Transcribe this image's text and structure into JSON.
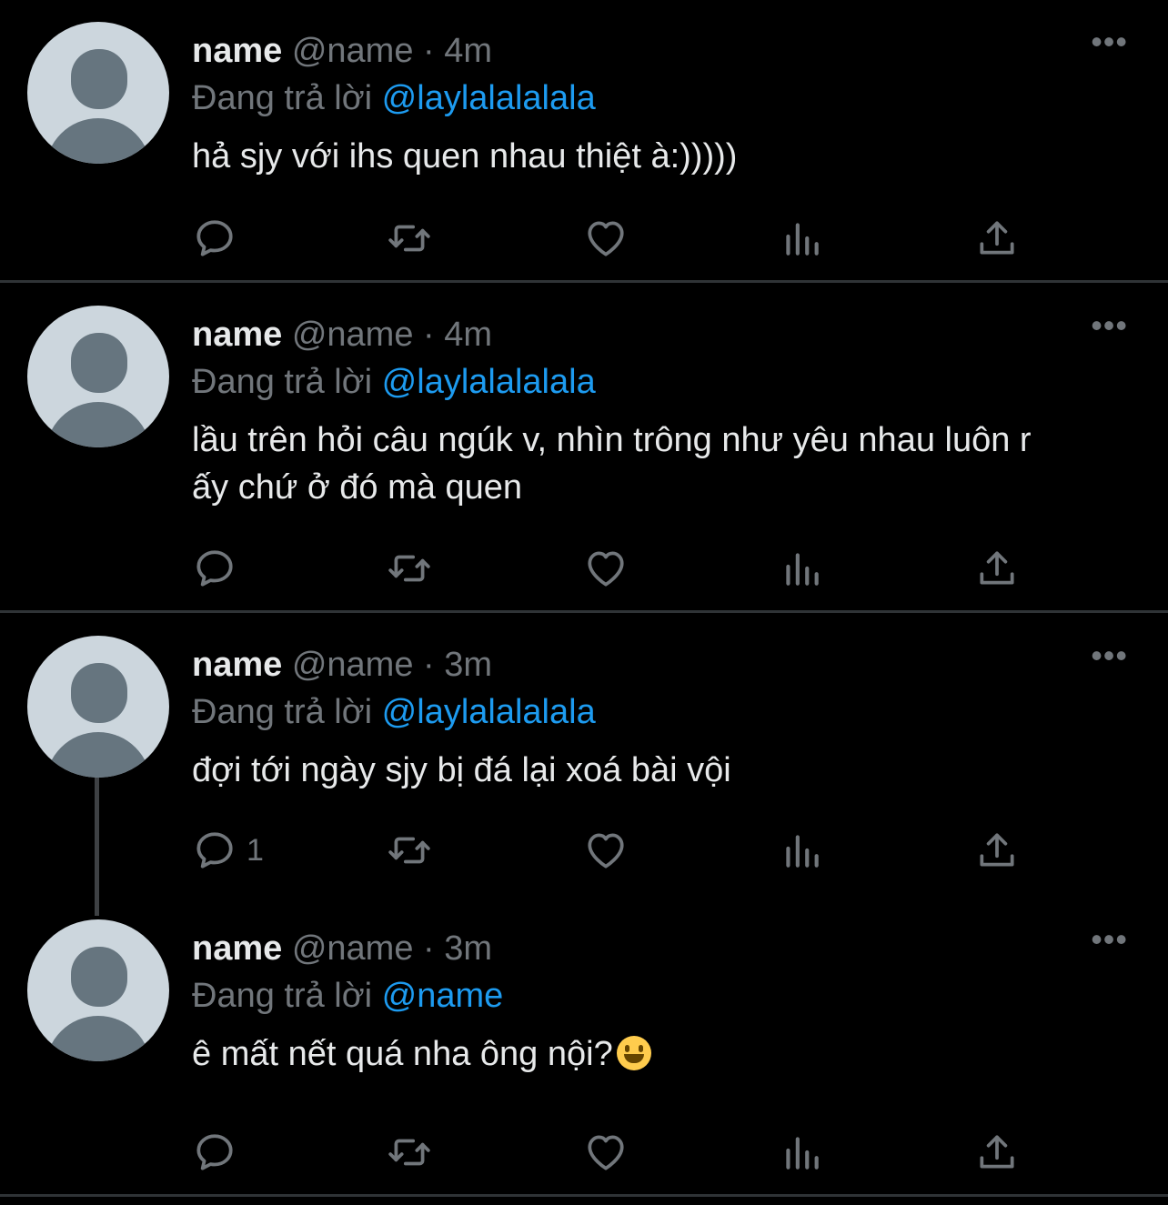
{
  "tweets": [
    {
      "display_name": "name",
      "handle": "@name",
      "separator": "·",
      "time": "4m",
      "reply_prefix": "Đang trả lời",
      "reply_to": "@laylalalalala",
      "text": "hả sjy với ihs quen nhau thiệt à:)))))",
      "reply_count": ""
    },
    {
      "display_name": "name",
      "handle": "@name",
      "separator": "·",
      "time": "4m",
      "reply_prefix": "Đang trả lời",
      "reply_to": "@laylalalalala",
      "text": "lầu trên hỏi câu ngúk v, nhìn trông như yêu nhau luôn r ấy chứ ở đó mà quen",
      "reply_count": ""
    },
    {
      "display_name": "name",
      "handle": "@name",
      "separator": "·",
      "time": "3m",
      "reply_prefix": "Đang trả lời",
      "reply_to": "@laylalalalala",
      "text": "đợi tới ngày sjy bị đá lại xoá bài vội",
      "reply_count": "1"
    },
    {
      "display_name": "name",
      "handle": "@name",
      "separator": "·",
      "time": "3m",
      "reply_prefix": "Đang trả lời",
      "reply_to": "@name",
      "text": "ê mất nết quá nha ông nội?",
      "emoji": "grinning-face-emoji",
      "reply_count": ""
    }
  ],
  "more_label": "•••",
  "icons": [
    "reply-icon",
    "retweet-icon",
    "like-icon",
    "views-icon",
    "share-icon",
    "more-icon"
  ],
  "colors": {
    "background": "#000000",
    "text": "#e7e9ea",
    "muted": "#71767b",
    "accent": "#1d9bf0",
    "divider": "#2f3336"
  }
}
